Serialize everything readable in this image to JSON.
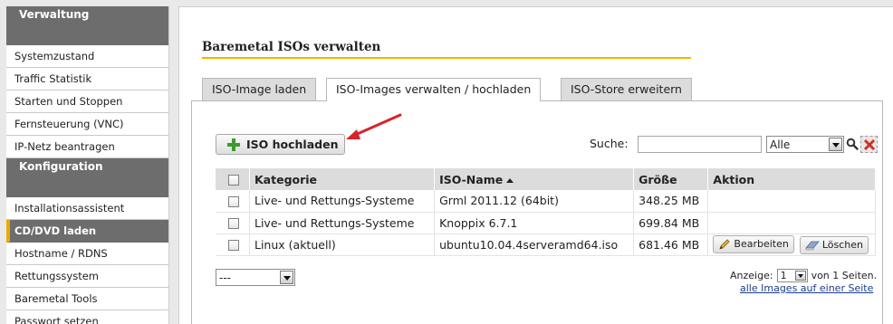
{
  "sidebar": {
    "section1_title": "Verwaltung",
    "items1": [
      "Systemzustand",
      "Traffic Statistik",
      "Starten und Stoppen",
      "Fernsteuerung (VNC)",
      "IP-Netz beantragen"
    ],
    "section2_title": "Konfiguration",
    "items2": [
      "Installationsassistent",
      "CD/DVD laden",
      "Hostname / RDNS",
      "Rettungssystem",
      "Baremetal Tools",
      "Passwort setzen"
    ],
    "active_item": "CD/DVD laden"
  },
  "main": {
    "title": "Baremetal ISOs verwalten",
    "tabs": [
      {
        "label": "ISO-Image laden",
        "active": false
      },
      {
        "label": "ISO-Images verwalten / hochladen",
        "active": true
      },
      {
        "label": "ISO-Store erweitern",
        "active": false
      }
    ],
    "upload_button": "ISO hochladen",
    "search_label": "Suche:",
    "search_value": "",
    "search_filter": "Alle",
    "table": {
      "headers": [
        "Kategorie",
        "ISO-Name",
        "Größe",
        "Aktion"
      ],
      "sort_column": "ISO-Name",
      "rows": [
        {
          "kategorie": "Live- und Rettungs-Systeme",
          "name": "Grml 2011.12 (64bit)",
          "groesse": "348.25 MB"
        },
        {
          "kategorie": "Live- und Rettungs-Systeme",
          "name": "Knoppix 6.7.1",
          "groesse": "699.84 MB"
        },
        {
          "kategorie": "Linux (aktuell)",
          "name": "ubuntu10.04.4serveramd64.iso",
          "groesse": "681.46 MB",
          "edit_label": "Bearbeiten",
          "delete_label": "Löschen"
        }
      ]
    },
    "bulk_action": "---",
    "pager": {
      "prefix": "Anzeige:",
      "page": "1",
      "suffix": "von 1 Seiten."
    },
    "all_link": "alle Images auf einer Seite"
  },
  "colors": {
    "accent": "#f0b400",
    "sidebar_header": "#6d6d6d",
    "plus_green": "#3e9a2c",
    "arrow_red": "#d8232a"
  }
}
